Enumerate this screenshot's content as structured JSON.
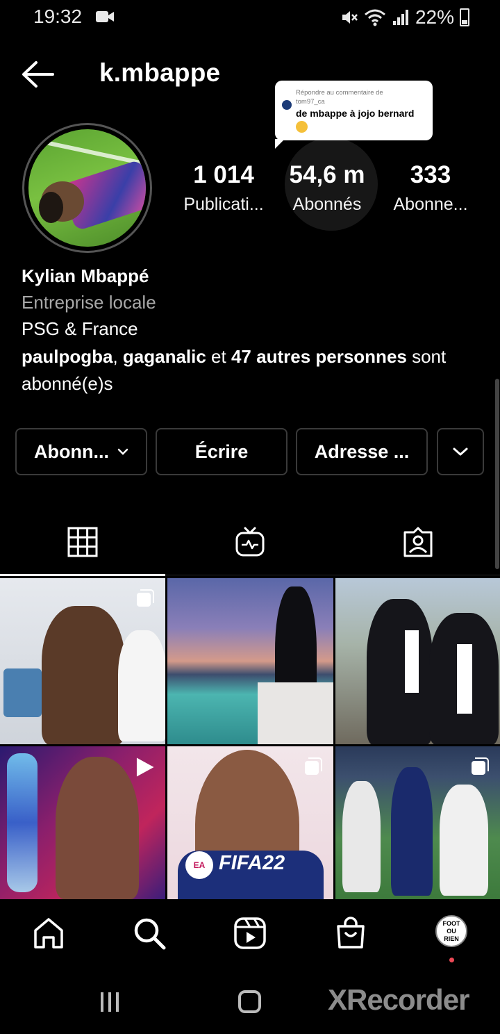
{
  "status_bar": {
    "time": "19:32",
    "battery": "22%"
  },
  "header": {
    "username": "k.mbappe"
  },
  "reply_bubble": {
    "line1": "Répondre au commentaire de",
    "line2": "tom97_ca",
    "text": "de mbappe à jojo bernard"
  },
  "stats": {
    "posts": {
      "value": "1 014",
      "label": "Publicati..."
    },
    "followers": {
      "value": "54,6 m",
      "label": "Abonnés"
    },
    "following": {
      "value": "333",
      "label": "Abonne..."
    }
  },
  "bio": {
    "name": "Kylian Mbappé",
    "category": "Entreprise locale",
    "text": "PSG & France",
    "followed_user1": "paulpogba",
    "followed_sep": ", ",
    "followed_user2": "gaganalic",
    "followed_and": " et ",
    "followed_others": "47 autres personnes",
    "followed_suffix": " sont abonné(e)s"
  },
  "actions": {
    "follow": "Abonn...",
    "write": "Écrire",
    "address": "Adresse ..."
  },
  "tabs": [
    {
      "icon": "grid-icon",
      "active": true
    },
    {
      "icon": "igtv-icon",
      "active": false
    },
    {
      "icon": "tagged-icon",
      "active": false
    }
  ],
  "posts": [
    {
      "badge": "carousel-icon"
    },
    {
      "badge": ""
    },
    {
      "badge": ""
    },
    {
      "badge": "play-icon"
    },
    {
      "badge": "carousel-icon",
      "overlay_text": "FIFA22",
      "logo_text": "EA"
    },
    {
      "badge": "carousel-icon"
    }
  ],
  "bottom_nav": {
    "profile_label_line1": "FOOT",
    "profile_label_line2": "OU",
    "profile_label_line3": "RIEN"
  },
  "watermark": "XRecorder",
  "colors": {
    "background": "#000000",
    "text": "#ffffff",
    "muted": "#a8a8a8",
    "notification_dot": "#ed4956"
  }
}
